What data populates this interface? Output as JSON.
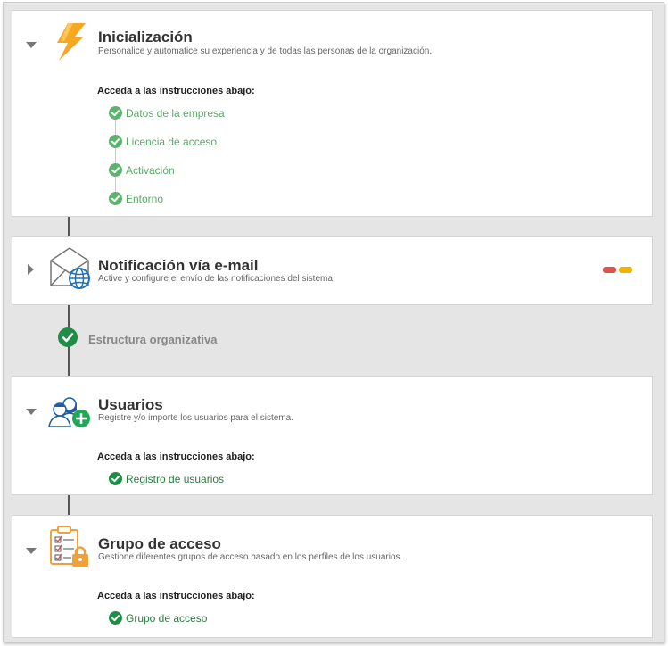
{
  "colors": {
    "done_light": "#5cb36f",
    "done_dark": "#1e8d45",
    "link_light": "#5aaa6a",
    "link_dark": "#2a7d42",
    "badge_red": "#d9534f",
    "badge_yellow": "#f0b400"
  },
  "cards": [
    {
      "title": "Inicialización",
      "subtitle": "Personalice y automatice su experiencia y de todas las personas de la organización.",
      "icon": "lightning-icon",
      "expanded": true,
      "instructions_label": "Acceda a las instrucciones abajo:",
      "steps": [
        {
          "label": "Datos de la empresa",
          "status": "done"
        },
        {
          "label": "Licencia de acceso",
          "status": "done"
        },
        {
          "label": "Activación",
          "status": "done"
        },
        {
          "label": "Entorno",
          "status": "done"
        }
      ]
    },
    {
      "title": "Notificación vía e-mail",
      "subtitle": "Active y configure el envío de las notificaciones del sistema.",
      "icon": "email-globe-icon",
      "expanded": false,
      "status_badges": [
        "red",
        "yellow"
      ]
    },
    {
      "title": "Usuarios",
      "subtitle": "Registre y/o importe los usuarios para el sistema.",
      "icon": "add-users-icon",
      "expanded": true,
      "instructions_label": "Acceda a las instrucciones abajo:",
      "steps": [
        {
          "label": "Registro de usuarios",
          "status": "done"
        }
      ]
    },
    {
      "title": "Grupo de acceso",
      "subtitle": "Gestione diferentes grupos de acceso basado en los perfiles de los usuarios.",
      "icon": "clipboard-lock-icon",
      "expanded": true,
      "instructions_label": "Acceda a las instrucciones abajo:",
      "steps": [
        {
          "label": "Grupo de acceso",
          "status": "done"
        }
      ]
    }
  ],
  "section": {
    "label": "Estructura organizativa",
    "status": "done"
  }
}
